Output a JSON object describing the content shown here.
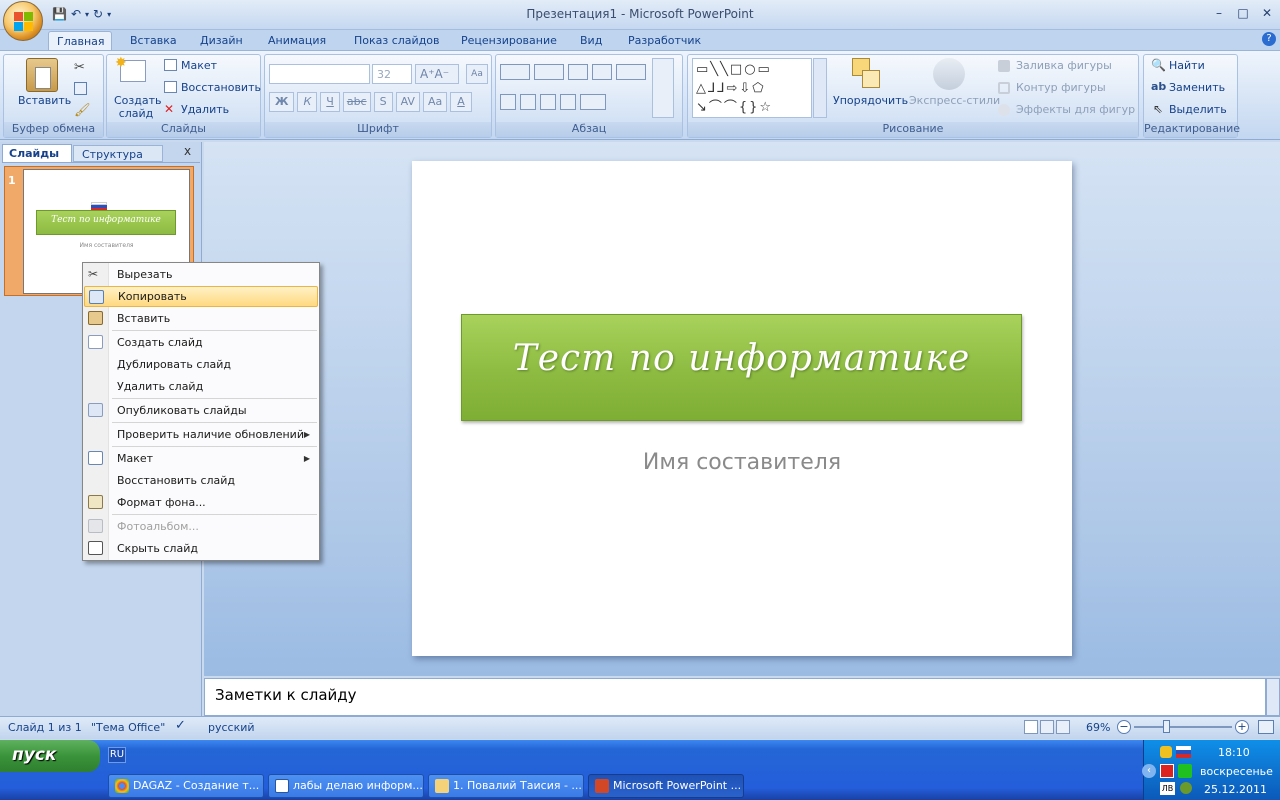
{
  "window": {
    "title": "Презентация1 - Microsoft PowerPoint",
    "controls": [
      "–",
      "□",
      "✕"
    ]
  },
  "tabs": [
    "Главная",
    "Вставка",
    "Дизайн",
    "Анимация",
    "Показ слайдов",
    "Рецензирование",
    "Вид",
    "Разработчик"
  ],
  "ribbon": {
    "clipboard": {
      "paste": "Вставить",
      "label": "Буфер обмена"
    },
    "slides": {
      "new_slide": "Создать слайд",
      "layout": "Макет",
      "reset": "Восстановить",
      "delete": "Удалить",
      "label": "Слайды"
    },
    "font": {
      "size": "32",
      "label": "Шрифт",
      "buttons": [
        "Ж",
        "К",
        "Ч",
        "abc",
        "S",
        "AV",
        "Aa",
        "A"
      ]
    },
    "paragraph": {
      "label": "Абзац"
    },
    "drawing": {
      "arrange": "Упорядочить",
      "quick_styles": "Экспресс-стили",
      "fill": "Заливка фигуры",
      "outline": "Контур фигуры",
      "effects": "Эффекты для фигур",
      "label": "Рисование"
    },
    "editing": {
      "find": "Найти",
      "replace": "Заменить",
      "select": "Выделить",
      "label": "Редактирование"
    }
  },
  "sidebar": {
    "tabs": [
      "Слайды",
      "Структура"
    ],
    "close": "x",
    "slide_number": "1",
    "thumb_title": "Тест по информатике",
    "thumb_subtitle": "Имя составителя"
  },
  "slide": {
    "title": "Тест по информатике",
    "subtitle": "Имя составителя"
  },
  "notes": {
    "placeholder": "Заметки к слайду"
  },
  "context_menu": {
    "items": [
      "Вырезать",
      "Копировать",
      "Вставить",
      "Создать слайд",
      "Дублировать слайд",
      "Удалить слайд",
      "Опубликовать слайды",
      "Проверить наличие обновлений",
      "Макет",
      "Восстановить слайд",
      "Формат фона...",
      "Фотоальбом...",
      "Скрыть слайд"
    ],
    "highlighted": "Копировать",
    "disabled": "Фотоальбом..."
  },
  "status": {
    "slide_info": "Слайд 1 из 1",
    "theme": "\"Тема Office\"",
    "language": "русский",
    "zoom": "69%"
  },
  "taskbar": {
    "start": "пуск",
    "lang": "RU",
    "tasks": [
      "DAGAZ - Создание т...",
      "лабы делаю информ...",
      "1. Повалий Таисия - ...",
      "Microsoft PowerPoint ..."
    ],
    "time": "18:10",
    "day": "воскресенье",
    "date": "25.12.2011",
    "tray_lang": "ЛВ"
  },
  "colors": {
    "accent": "#15428b",
    "title_green": "#8dbb42",
    "highlight": "#ffd980",
    "thumb_selected": "#f0a968"
  }
}
